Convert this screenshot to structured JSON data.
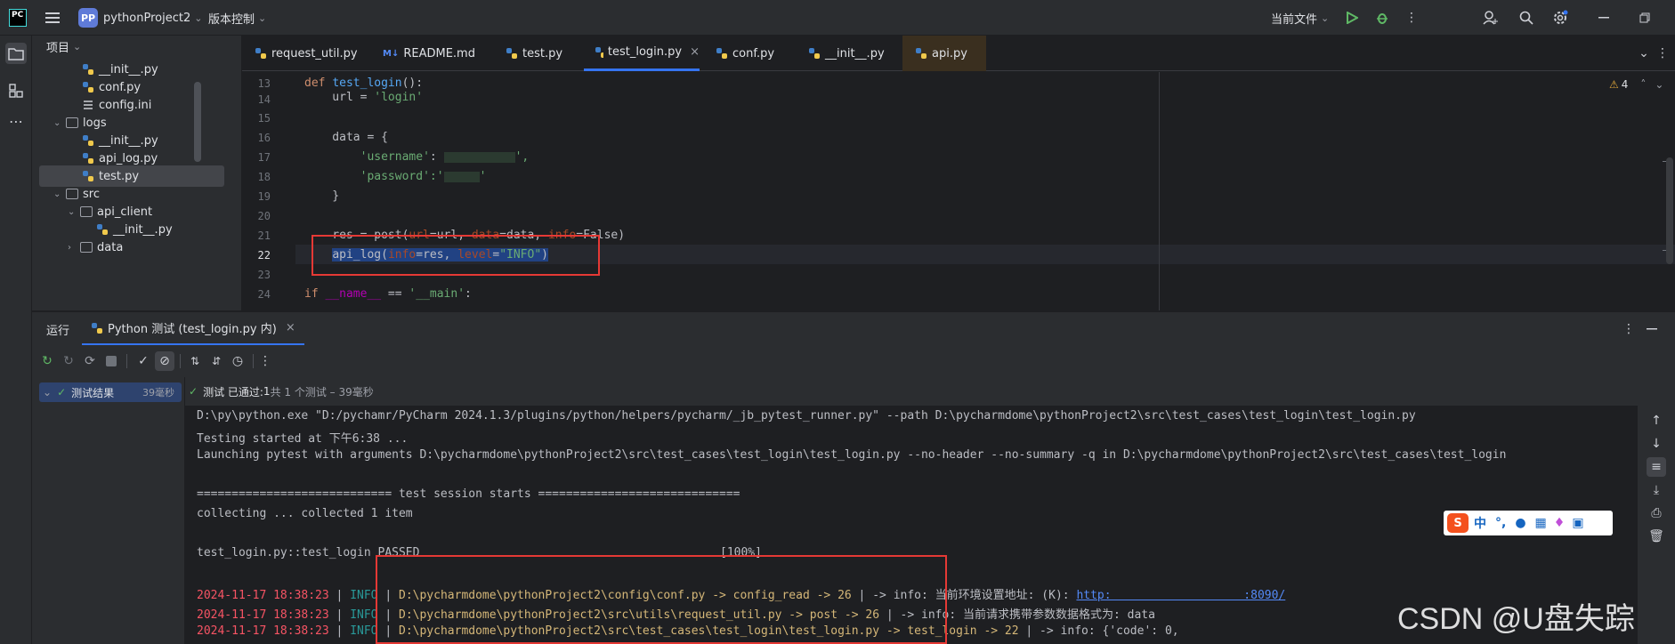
{
  "titlebar": {
    "project_badge": "PP",
    "project_name": "pythonProject2",
    "vcs": "版本控制",
    "run_config": "当前文件"
  },
  "project_panel": {
    "title": "项目",
    "tree": [
      {
        "label": "__init__.py",
        "type": "py"
      },
      {
        "label": "conf.py",
        "type": "py"
      },
      {
        "label": "config.ini",
        "type": "ini"
      },
      {
        "label": "logs",
        "type": "folder"
      },
      {
        "label": "__init__.py",
        "type": "py"
      },
      {
        "label": "api_log.py",
        "type": "py"
      },
      {
        "label": "test.py",
        "type": "py"
      },
      {
        "label": "src",
        "type": "folder"
      },
      {
        "label": "api_client",
        "type": "package"
      },
      {
        "label": "__init__.py",
        "type": "py"
      },
      {
        "label": "data",
        "type": "package"
      }
    ]
  },
  "tabs": [
    {
      "label": "request_util.py"
    },
    {
      "label": "README.md"
    },
    {
      "label": "test.py"
    },
    {
      "label": "test_login.py"
    },
    {
      "label": "conf.py"
    },
    {
      "label": "__init__.py"
    },
    {
      "label": "api.py"
    }
  ],
  "editor": {
    "warnings": "4",
    "line_numbers": [
      "13",
      "14",
      "15",
      "16",
      "17",
      "18",
      "19",
      "20",
      "21",
      "22",
      "23",
      "24"
    ],
    "lines": {
      "l13_kw": "def ",
      "l13_fn": "test_login",
      "l13_rest": "():",
      "l14": "    url = ",
      "l14_str": "'login'",
      "l16": "    data = {",
      "l17_str": "'username'",
      "l17_rest": ": ",
      "l17_tail": "',",
      "l18_str": "'password'",
      "l18_rest": ":'",
      "l18_tail": "'",
      "l19": "    }",
      "l21_a": "    res = post(",
      "l21_p1": "url",
      "l21_b": "=url, ",
      "l21_p2": "data",
      "l21_c": "=data, ",
      "l21_p3": "info",
      "l21_d": "=False)",
      "l22_a": "api_log(",
      "l22_p1": "info",
      "l22_b": "=res, ",
      "l22_p2": "level",
      "l22_c": "=",
      "l22_str": "\"INFO\"",
      "l22_d": ")",
      "l24_kw": "if ",
      "l24_dunder": "__name__",
      "l24_b": " == ",
      "l24_str": "'__main'",
      "l24_c": ":"
    }
  },
  "run_panel": {
    "title": "运行",
    "tab_label": "Python 测试 (test_login.py 内)",
    "tree_item": "测试结果",
    "tree_time": "39毫秒",
    "status_prefix": "测试 已通过: ",
    "status_count": "1",
    "status_suffix": "共 1 个测试 – 39毫秒",
    "console": {
      "l1": "D:\\py\\python.exe \"D:/pychamr/PyCharm 2024.1.3/plugins/python/helpers/pycharm/_jb_pytest_runner.py\" --path D:\\pycharmdome\\pythonProject2\\src\\test_cases\\test_login\\test_login.py",
      "l2": "Testing started at 下午6:38 ...",
      "l3": "Launching pytest with arguments D:\\pycharmdome\\pythonProject2\\src\\test_cases\\test_login\\test_login.py --no-header --no-summary -q in D:\\pycharmdome\\pythonProject2\\src\\test_cases\\test_login",
      "l5": "============================ test session starts =============================",
      "l6": "collecting ... collected 1 item",
      "l8a": "test_login.py::test_login PASSED",
      "l8b": "[100%]",
      "log1_ts": "2024-11-17 18:38:23",
      "log1_lvl": "INFO",
      "log1_path": "D:\\pycharmdome\\pythonProject2\\config\\conf.py -> config_read -> 26",
      "log1_msg": " | -> info: 当前环境设置地址: (K): ",
      "log1_link": "http:                   :8090/",
      "log2_ts": "2024-11-17 18:38:23",
      "log2_lvl": "INFO",
      "log2_path": "D:\\pycharmdome\\pythonProject2\\src\\utils\\request_util.py -> post -> 26",
      "log2_msg": " | -> info: 当前请求携带参数数据格式为: data",
      "log3_ts": "2024-11-17 18:38:23",
      "log3_lvl": "INFO",
      "log3_path": "D:\\pycharmdome\\pythonProject2\\src\\test_cases\\test_login\\test_login.py -> test_login -> 22",
      "log3_msg": " | -> info: {'code': 0,"
    }
  },
  "ime_bar": {
    "label": "中"
  },
  "watermark": "CSDN @U盘失踪了",
  "colors": {
    "accent": "#3574f0",
    "annotation_red": "#e53935"
  }
}
